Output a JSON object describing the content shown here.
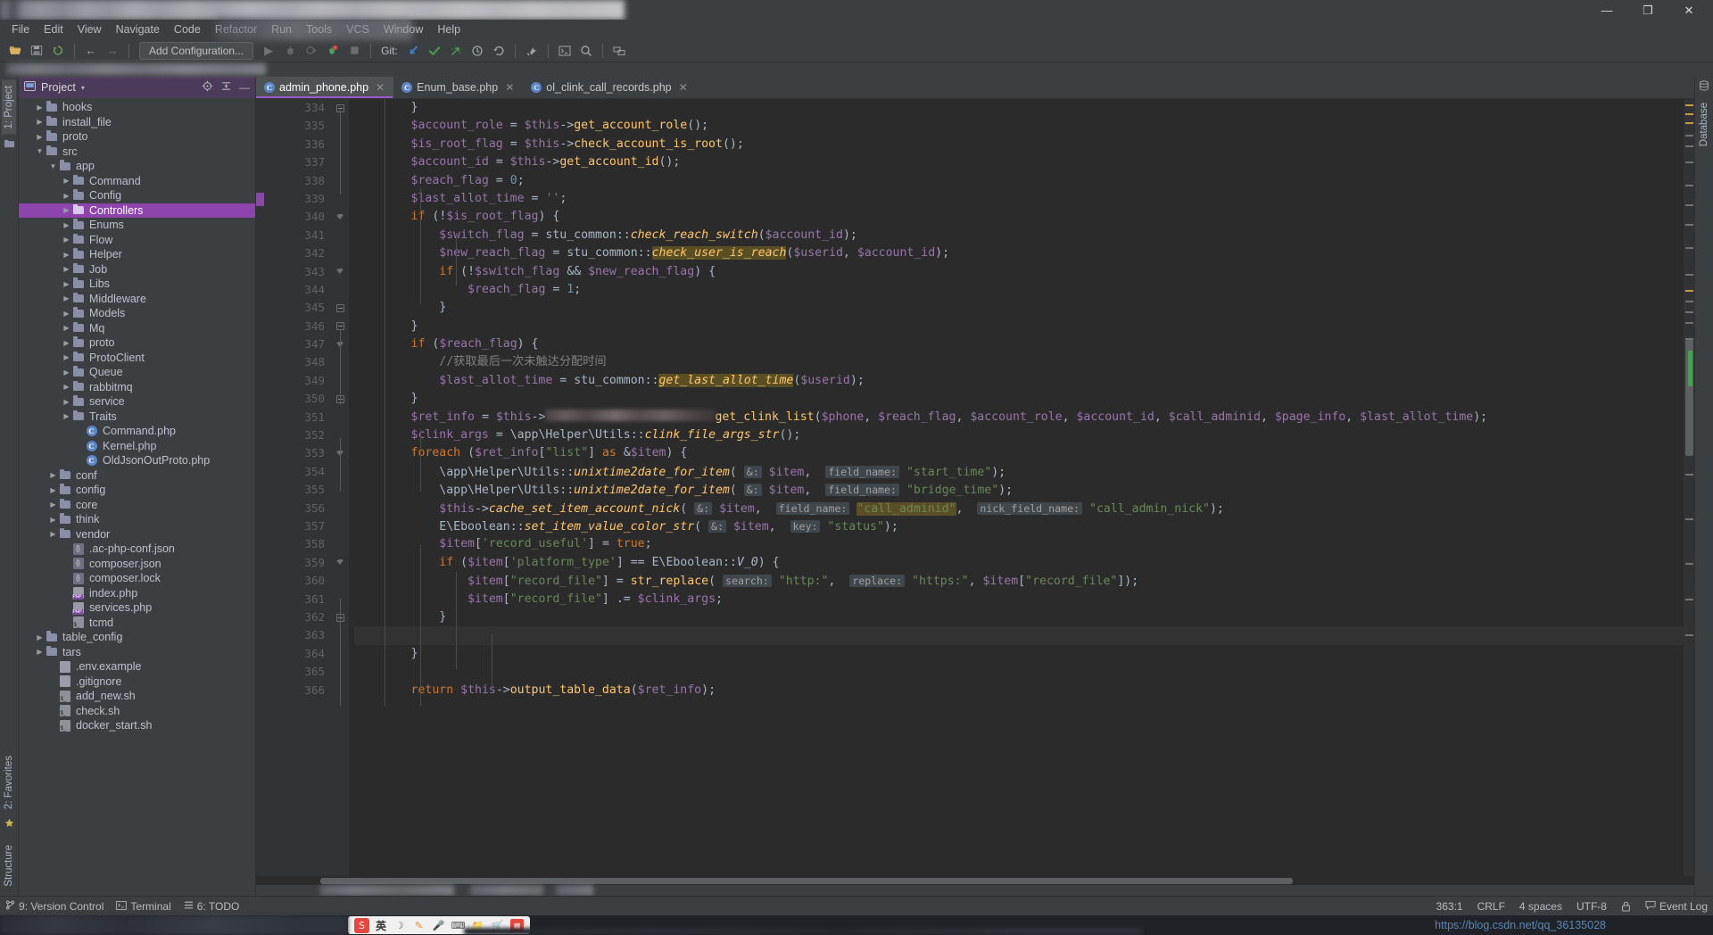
{
  "window": {
    "title_redacted": true,
    "controls": {
      "minimize": "—",
      "maximize": "❐",
      "close": "✕"
    }
  },
  "menubar": {
    "items": [
      {
        "label": "File"
      },
      {
        "label": "Edit"
      },
      {
        "label": "View"
      },
      {
        "label": "Navigate"
      },
      {
        "label": "Code"
      },
      {
        "label": "Refactor"
      },
      {
        "label": "Run"
      },
      {
        "label": "Tools"
      },
      {
        "label": "VCS"
      },
      {
        "label": "Window"
      },
      {
        "label": "Help"
      }
    ]
  },
  "toolbar": {
    "run_config_label": "Add Configuration...",
    "git_label": "Git:",
    "icons": [
      "open-folder-icon",
      "save-all-icon",
      "sync-icon",
      "back-arrow-icon",
      "forward-arrow-icon"
    ],
    "run_icons": [
      "run-icon",
      "debug-icon",
      "run-coverage-icon",
      "stop-debug-icon",
      "stop-icon"
    ],
    "git_icons": [
      "update-project-icon",
      "commit-icon",
      "push-icon",
      "history-icon",
      "rollback-icon"
    ],
    "right_icons": [
      "build-icon",
      "terminal-icon",
      "search-everywhere-icon",
      "settings-sync-icon"
    ]
  },
  "left_rail": {
    "top": [
      {
        "label": "1: Project",
        "icon": "project-icon",
        "active": true
      }
    ],
    "bottom": [
      {
        "label": "2: Favorites",
        "icon": "star-icon"
      },
      {
        "label": "Structure",
        "icon": "structure-icon"
      }
    ]
  },
  "right_rail": {
    "items": [
      {
        "label": "Database",
        "icon": "database-icon"
      }
    ]
  },
  "project_panel": {
    "title": "Project",
    "caret": "▾",
    "actions": [
      "target-icon",
      "collapse-all-icon",
      "hide-icon"
    ],
    "tree": [
      {
        "label": "hooks",
        "indent": 2,
        "type": "folder",
        "arrow": "▶"
      },
      {
        "label": "install_file",
        "indent": 2,
        "type": "folder",
        "arrow": "▶"
      },
      {
        "label": "proto",
        "indent": 2,
        "type": "folder",
        "arrow": "▶"
      },
      {
        "label": "src",
        "indent": 2,
        "type": "folder",
        "arrow": "▼"
      },
      {
        "label": "app",
        "indent": 3,
        "type": "folder",
        "arrow": "▼"
      },
      {
        "label": "Command",
        "indent": 4,
        "type": "folder",
        "arrow": "▶"
      },
      {
        "label": "Config",
        "indent": 4,
        "type": "folder",
        "arrow": "▶"
      },
      {
        "label": "Controllers",
        "indent": 4,
        "type": "folder",
        "arrow": "▶",
        "selected": true
      },
      {
        "label": "Enums",
        "indent": 4,
        "type": "folder",
        "arrow": "▶"
      },
      {
        "label": "Flow",
        "indent": 4,
        "type": "folder",
        "arrow": "▶"
      },
      {
        "label": "Helper",
        "indent": 4,
        "type": "folder",
        "arrow": "▶"
      },
      {
        "label": "Job",
        "indent": 4,
        "type": "folder",
        "arrow": "▶"
      },
      {
        "label": "Libs",
        "indent": 4,
        "type": "folder",
        "arrow": "▶"
      },
      {
        "label": "Middleware",
        "indent": 4,
        "type": "folder",
        "arrow": "▶"
      },
      {
        "label": "Models",
        "indent": 4,
        "type": "folder",
        "arrow": "▶"
      },
      {
        "label": "Mq",
        "indent": 4,
        "type": "folder",
        "arrow": "▶"
      },
      {
        "label": "proto",
        "indent": 4,
        "type": "folder",
        "arrow": "▶"
      },
      {
        "label": "ProtoClient",
        "indent": 4,
        "type": "folder",
        "arrow": "▶"
      },
      {
        "label": "Queue",
        "indent": 4,
        "type": "folder",
        "arrow": "▶"
      },
      {
        "label": "rabbitmq",
        "indent": 4,
        "type": "folder",
        "arrow": "▶"
      },
      {
        "label": "service",
        "indent": 4,
        "type": "folder",
        "arrow": "▶"
      },
      {
        "label": "Traits",
        "indent": 4,
        "type": "folder",
        "arrow": "▶"
      },
      {
        "label": "Command.php",
        "indent": 5,
        "type": "class"
      },
      {
        "label": "Kernel.php",
        "indent": 5,
        "type": "class"
      },
      {
        "label": "OldJsonOutProto.php",
        "indent": 5,
        "type": "class"
      },
      {
        "label": "conf",
        "indent": 3,
        "type": "folder",
        "arrow": "▶"
      },
      {
        "label": "config",
        "indent": 3,
        "type": "folder",
        "arrow": "▶"
      },
      {
        "label": "core",
        "indent": 3,
        "type": "folder",
        "arrow": "▶"
      },
      {
        "label": "think",
        "indent": 3,
        "type": "folder",
        "arrow": "▶"
      },
      {
        "label": "vendor",
        "indent": 3,
        "type": "folder",
        "arrow": "▶"
      },
      {
        "label": ".ac-php-conf.json",
        "indent": 4,
        "type": "json"
      },
      {
        "label": "composer.json",
        "indent": 4,
        "type": "json"
      },
      {
        "label": "composer.lock",
        "indent": 4,
        "type": "json"
      },
      {
        "label": "index.php",
        "indent": 4,
        "type": "php"
      },
      {
        "label": "services.php",
        "indent": 4,
        "type": "php"
      },
      {
        "label": "tcmd",
        "indent": 4,
        "type": "sh"
      },
      {
        "label": "table_config",
        "indent": 2,
        "type": "folder",
        "arrow": "▶"
      },
      {
        "label": "tars",
        "indent": 2,
        "type": "folder",
        "arrow": "▶"
      },
      {
        "label": ".env.example",
        "indent": 3,
        "type": "txt"
      },
      {
        "label": ".gitignore",
        "indent": 3,
        "type": "txt"
      },
      {
        "label": "add_new.sh",
        "indent": 3,
        "type": "sh"
      },
      {
        "label": "check.sh",
        "indent": 3,
        "type": "sh"
      },
      {
        "label": "docker_start.sh",
        "indent": 3,
        "type": "sh"
      }
    ]
  },
  "editor": {
    "tabs": [
      {
        "label": "admin_phone.php",
        "icon": "php-class-icon",
        "active": true,
        "close": "✕"
      },
      {
        "label": "Enum_base.php",
        "icon": "php-class-icon",
        "active": false,
        "close": "✕"
      },
      {
        "label": "ol_clink_call_records.php",
        "icon": "php-class-icon",
        "active": false,
        "close": "✕"
      }
    ],
    "first_line_number": 334,
    "lines": [
      {
        "n": 334,
        "fold": "end",
        "html": "        <span class='def'>}</span>"
      },
      {
        "n": 335,
        "html": "        <span class='var'>$account_role</span> <span class='def'>=</span> <span class='var'>$this</span><span class='def'>-&gt;</span><span class='fn'>get_account_role</span><span class='def'>();</span>"
      },
      {
        "n": 336,
        "html": "        <span class='var'>$is_root_flag</span> <span class='def'>=</span> <span class='var'>$this</span><span class='def'>-&gt;</span><span class='fn'>check_account_is_root</span><span class='def'>();</span>"
      },
      {
        "n": 337,
        "html": "        <span class='var'>$account_id</span> <span class='def'>=</span> <span class='var'>$this</span><span class='def'>-&gt;</span><span class='fn'>get_account_id</span><span class='def'>();</span>"
      },
      {
        "n": 338,
        "html": "        <span class='var'>$reach_flag</span> <span class='def'>=</span> <span class='num'>0</span><span class='def'>;</span>"
      },
      {
        "n": 339,
        "html": "        <span class='var'>$last_allot_time</span> <span class='def'>=</span> <span class='str'>''</span><span class='def'>;</span>"
      },
      {
        "n": 340,
        "fold": "open",
        "html": "        <span class='kw'>if</span> <span class='def'>(!</span><span class='var'>$is_root_flag</span><span class='def'>) {</span>"
      },
      {
        "n": 341,
        "html": "            <span class='var'>$switch_flag</span> <span class='def'>=</span> <span class='cls'>stu_common</span><span class='def'>::</span><span class='fn-i'>check_reach_switch</span><span class='def'>(</span><span class='var'>$account_id</span><span class='def'>);</span>"
      },
      {
        "n": 342,
        "html": "            <span class='var'>$new_reach_flag</span> <span class='def'>=</span> <span class='cls'>stu_common</span><span class='def'>::</span><span class='fn-i hl-search'>check_user_is_reach</span><span class='def'>(</span><span class='var'>$userid</span><span class='def'>,</span> <span class='var'>$account_id</span><span class='def'>);</span>"
      },
      {
        "n": 343,
        "fold": "open",
        "html": "            <span class='kw'>if</span> <span class='def'>(!</span><span class='var'>$switch_flag</span> <span class='def'>&amp;&amp;</span> <span class='var'>$new_reach_flag</span><span class='def'>) {</span>"
      },
      {
        "n": 344,
        "html": "                <span class='var'>$reach_flag</span> <span class='def'>=</span> <span class='num'>1</span><span class='def'>;</span>"
      },
      {
        "n": 345,
        "fold": "end",
        "html": "            <span class='def'>}</span>"
      },
      {
        "n": 346,
        "fold": "end",
        "html": "        <span class='def'>}</span>"
      },
      {
        "n": 347,
        "fold": "open",
        "html": "        <span class='kw'>if</span> <span class='def'>(</span><span class='var'>$reach_flag</span><span class='def'>) {</span>"
      },
      {
        "n": 348,
        "html": "            <span class='cm'>//获取最后一次未触达分配时间</span>"
      },
      {
        "n": 349,
        "html": "            <span class='var'>$last_allot_time</span> <span class='def'>=</span> <span class='cls'>stu_common</span><span class='def'>::</span><span class='fn-i hl-search'>get_last_allot_time</span><span class='def'>(</span><span class='var'>$userid</span><span class='def'>);</span>"
      },
      {
        "n": 350,
        "fold": "end",
        "html": "        <span class='def'>}</span>"
      },
      {
        "n": 351,
        "html": "        <span class='var'>$ret_info</span> <span class='def'>=</span> <span class='var'>$this</span><span class='def'>-&gt;</span><span class='redact'></span><span class='fn'>get_clink_list</span><span class='def'>(</span><span class='var'>$phone</span><span class='def'>,</span> <span class='var'>$reach_flag</span><span class='def'>,</span> <span class='var'>$account_role</span><span class='def'>,</span> <span class='var'>$account_id</span><span class='def'>,</span> <span class='var'>$call_adminid</span><span class='def'>,</span> <span class='var'>$page_info</span><span class='def'>,</span> <span class='var'>$last_allot_time</span><span class='def'>);</span>"
      },
      {
        "n": 352,
        "html": "        <span class='var'>$clink_args</span> <span class='def'>=</span> <span class='def'>\\app\\Helper\\Utils</span><span class='def'>::</span><span class='fn-i'>clink_file_args_str</span><span class='def'>();</span>"
      },
      {
        "n": 353,
        "fold": "open",
        "html": "        <span class='kw'>foreach</span> <span class='def'>(</span><span class='var'>$ret_info</span><span class='def'>[</span><span class='str'>\"list\"</span><span class='def'>]</span> <span class='kw'>as</span> <span class='def'>&amp;</span><span class='var'>$item</span><span class='def'>) {</span>"
      },
      {
        "n": 354,
        "html": "            <span class='def'>\\app\\Helper\\Utils</span><span class='def'>::</span><span class='fn-i'>unixtime2date_for_item</span><span class='def'>(</span> <span class='hint'>&amp;:</span> <span class='var'>$item</span><span class='def'>,</span>  <span class='hint'>field_name:</span> <span class='str'>\"start_time\"</span><span class='def'>);</span>"
      },
      {
        "n": 355,
        "html": "            <span class='def'>\\app\\Helper\\Utils</span><span class='def'>::</span><span class='fn-i'>unixtime2date_for_item</span><span class='def'>(</span> <span class='hint'>&amp;:</span> <span class='var'>$item</span><span class='def'>,</span>  <span class='hint'>field_name:</span> <span class='str'>\"bridge_time\"</span><span class='def'>);</span>"
      },
      {
        "n": 356,
        "html": "            <span class='var'>$this</span><span class='def'>-&gt;</span><span class='fn-i'>cache_set_item_account_nick</span><span class='def'>(</span> <span class='hint'>&amp;:</span> <span class='var'>$item</span><span class='def'>,</span>  <span class='hint'>field_name:</span> <span class='str hl-search'>\"call_adminid\"</span><span class='def'>,</span>  <span class='hint'>nick_field_name:</span> <span class='str'>\"call_admin_nick\"</span><span class='def'>);</span>"
      },
      {
        "n": 357,
        "html": "            <span class='cls'>E\\Eboolean</span><span class='def'>::</span><span class='fn-i'>set_item_value_color_str</span><span class='def'>(</span> <span class='hint'>&amp;:</span> <span class='var'>$item</span><span class='def'>,</span>  <span class='hint'>key:</span> <span class='str'>\"status\"</span><span class='def'>);</span>"
      },
      {
        "n": 358,
        "html": "            <span class='var'>$item</span><span class='def'>[</span><span class='str'>'record_useful'</span><span class='def'>]</span> <span class='def'>=</span> <span class='kw'>true</span><span class='def'>;</span>"
      },
      {
        "n": 359,
        "fold": "open",
        "html": "            <span class='kw'>if</span> <span class='def'>(</span><span class='var'>$item</span><span class='def'>[</span><span class='str'>'platform_type'</span><span class='def'>]</span> <span class='def'>==</span> <span class='cls'>E\\Eboolean</span><span class='def'>::</span><span class='ident-i'>V_0</span><span class='def'>) {</span>"
      },
      {
        "n": 360,
        "html": "                <span class='var'>$item</span><span class='def'>[</span><span class='str'>\"record_file\"</span><span class='def'>]</span> <span class='def'>=</span> <span class='fn'>str_replace</span><span class='def'>(</span> <span class='hint'>search:</span> <span class='str'>\"http:\"</span><span class='def'>,</span>  <span class='hint'>replace:</span> <span class='str'>\"https:\"</span><span class='def'>,</span> <span class='var'>$item</span><span class='def'>[</span><span class='str'>\"record_file\"</span><span class='def'>]);</span>"
      },
      {
        "n": 361,
        "html": "                <span class='var'>$item</span><span class='def'>[</span><span class='str'>\"record_file\"</span><span class='def'>]</span> <span class='def'>.=</span> <span class='var'>$clink_args</span><span class='def'>;</span>"
      },
      {
        "n": 362,
        "fold": "end",
        "html": "            <span class='def'>}</span>"
      },
      {
        "n": 363,
        "cursor": true,
        "html": ""
      },
      {
        "n": 364,
        "html": "        <span class='def'>}</span>"
      },
      {
        "n": 365,
        "html": ""
      },
      {
        "n": 366,
        "html": "        <span class='kw'>return</span> <span class='var'>$this</span><span class='def'>-&gt;</span><span class='fn'>output_table_data</span><span class='def'>(</span><span class='var'>$ret_info</span><span class='def'>);</span>"
      }
    ]
  },
  "statusbar": {
    "left": [
      {
        "label": "9: Version Control",
        "icon": "vcs-icon"
      },
      {
        "label": "Terminal",
        "icon": "terminal-icon"
      },
      {
        "label": "6: TODO",
        "icon": "todo-icon"
      }
    ],
    "caret_position": "363:1",
    "line_separator": "CRLF",
    "encoding": "UTF-8",
    "indent": "4 spaces",
    "event_log": "Event Log",
    "event_log_icon": "balloon-icon",
    "lock_icon": "lock-icon"
  },
  "taskbar": {
    "ime": {
      "app_icon": "sogou-icon",
      "mode_label": "英",
      "icons": [
        "moon-icon",
        "pencil-icon",
        "mic-icon",
        "keyboard-icon",
        "folder-icon",
        "cart-icon",
        "grid-icon"
      ]
    },
    "watermark_url": "https://blog.csdn.net/qq_36135028"
  },
  "colors": {
    "accent_purple": "#8e44ad",
    "tab_underline": "#9b59d0",
    "editor_bg": "#2b2b2b",
    "panel_bg": "#3c3f41",
    "gutter_bg": "#313335",
    "keyword": "#cc7832",
    "variable": "#9876aa",
    "function": "#ffc66d",
    "string": "#6a8759",
    "number": "#6897bb",
    "comment": "#808080",
    "search_highlight": "#5a4e24"
  }
}
